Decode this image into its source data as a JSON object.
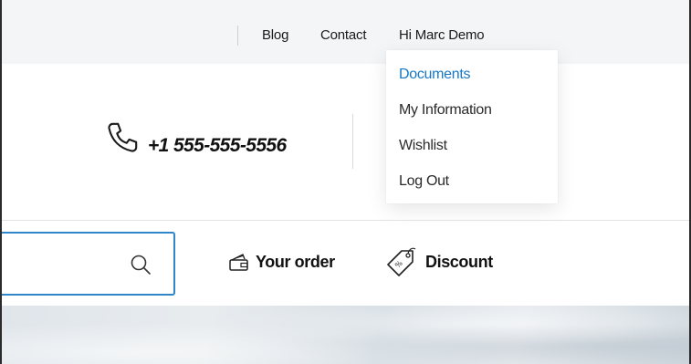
{
  "topbar": {
    "links": [
      {
        "label": "Blog"
      },
      {
        "label": "Contact"
      },
      {
        "label": "Hi Marc Demo"
      }
    ]
  },
  "header": {
    "phone_icon": "phone-icon",
    "phone_number": "+1 555-555-5556"
  },
  "user_menu": {
    "items": [
      {
        "label": "Documents",
        "active": true
      },
      {
        "label": "My Information",
        "active": false
      },
      {
        "label": "Wishlist",
        "active": false
      },
      {
        "label": "Log Out",
        "active": false
      }
    ]
  },
  "search": {
    "value": "",
    "placeholder": "",
    "icon": "search-icon"
  },
  "nav": {
    "your_order": "Your order",
    "discount": "Discount"
  },
  "colors": {
    "accent": "#1677c4",
    "search_border": "#2f86c8",
    "topbar_bg": "#f4f5f7"
  }
}
